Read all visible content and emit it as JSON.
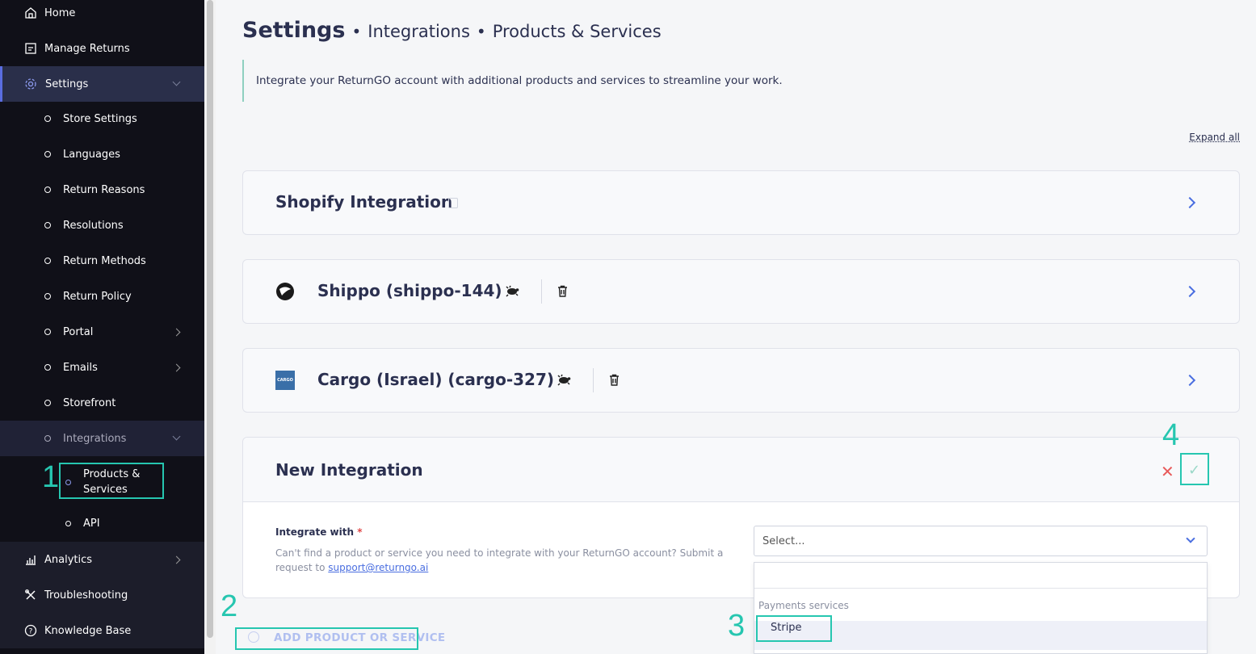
{
  "sidebar": {
    "items": [
      {
        "label": "Home",
        "icon": "home-icon"
      },
      {
        "label": "Manage Returns",
        "icon": "returns-icon"
      },
      {
        "label": "Settings",
        "icon": "gear-icon"
      },
      {
        "label": "Analytics",
        "icon": "analytics-icon"
      },
      {
        "label": "Troubleshooting",
        "icon": "tools-icon"
      },
      {
        "label": "Knowledge Base",
        "icon": "help-icon"
      }
    ],
    "settings_sub": [
      {
        "label": "Store Settings"
      },
      {
        "label": "Languages"
      },
      {
        "label": "Return Reasons"
      },
      {
        "label": "Resolutions"
      },
      {
        "label": "Return Methods"
      },
      {
        "label": "Return Policy"
      },
      {
        "label": "Portal"
      },
      {
        "label": "Emails"
      },
      {
        "label": "Storefront"
      },
      {
        "label": "Integrations"
      }
    ],
    "integrations_sub": [
      {
        "label_line1": "Products &",
        "label_line2": "Services"
      },
      {
        "label": "API"
      }
    ]
  },
  "annotations": [
    "1",
    "2",
    "3",
    "4"
  ],
  "header": {
    "title": "Settings",
    "sep": "•",
    "crumb1": "Integrations",
    "crumb2": "Products & Services"
  },
  "intro": "Integrate your ReturnGO account with additional products and services to streamline your work.",
  "expand_all": "Expand all",
  "cards": [
    {
      "title": "Shopify Integration"
    },
    {
      "title": "Shippo (shippo-144)"
    },
    {
      "title": "Cargo (Israel) (cargo-327)",
      "logo_text": "CARGO"
    }
  ],
  "new_integration": {
    "title": "New Integration",
    "cancel_glyph": "✕",
    "confirm_glyph": "✓",
    "field_label": "Integrate with",
    "required_mark": "*",
    "help_text": "Can't find a product or service you need to integrate with your ReturnGO account? Submit a request to ",
    "help_link": "support@returngo.ai",
    "select_placeholder": "Select...",
    "dropdown_group": "Payments services",
    "dropdown_option": "Stripe"
  },
  "add_button": "ADD PRODUCT OR SERVICE",
  "colors": {
    "accent": "#4a6ee0",
    "annotation": "#26c6b0",
    "sidebar": "#101018"
  }
}
